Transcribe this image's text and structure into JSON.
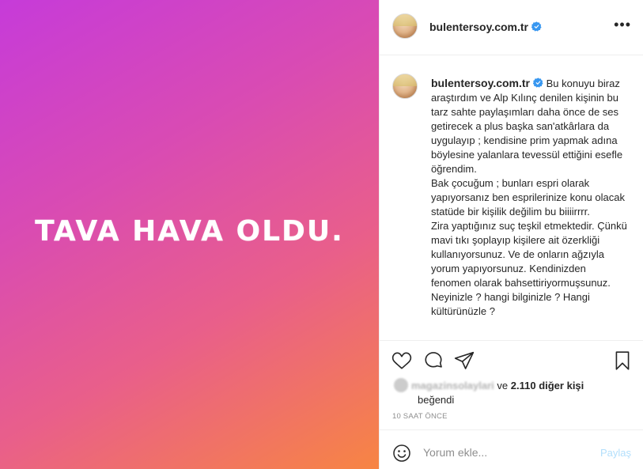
{
  "post": {
    "image_text": "TAVA HAVA OLDU."
  },
  "header": {
    "username": "bulentersoy.com.tr",
    "verified_icon": "verified-badge-icon",
    "more_icon": "more-options-icon",
    "more_glyph": "•••"
  },
  "caption": {
    "username": "bulentersoy.com.tr",
    "text": " Bu konuyu biraz araştırdım ve Alp Kılınç denilen kişinin bu tarz sahte paylaşımları daha önce de ses getirecek a plus başka san'atkârlara da uygulayıp ; kendisine prim yapmak adına böylesine yalanlara tevessül ettiğini esefle öğrendim.\nBak çocuğum ; bunları espri olarak yapıyorsanız ben esprilerinize konu olacak statüde bir kişilik değilim bu biiiirrrr.\nZira yaptığınız suç teşkil etmektedir. Çünkü mavi tıkı şoplayıp kişilere ait özerkliği kullanıyorsunuz. Ve de onların ağzıyla yorum yapıyorsunuz. Kendinizden fenomen olarak bahsettiriyormuşsunuz. Neyinizle ? hangi bilginizle ? Hangi kültürünüzle ?"
  },
  "actions": {
    "like_icon": "heart-icon",
    "comment_icon": "comment-icon",
    "share_icon": "share-icon",
    "save_icon": "bookmark-icon"
  },
  "likes": {
    "liker_name": "magazinsolaylari",
    "connector": "ve",
    "count_text": "2.110 diğer kişi",
    "suffix": "beğendi"
  },
  "timestamp": "10 SAAT ÖNCE",
  "comment_box": {
    "placeholder": "Yorum ekle...",
    "post_label": "Paylaş",
    "emoji_icon": "emoji-smiley-icon"
  }
}
